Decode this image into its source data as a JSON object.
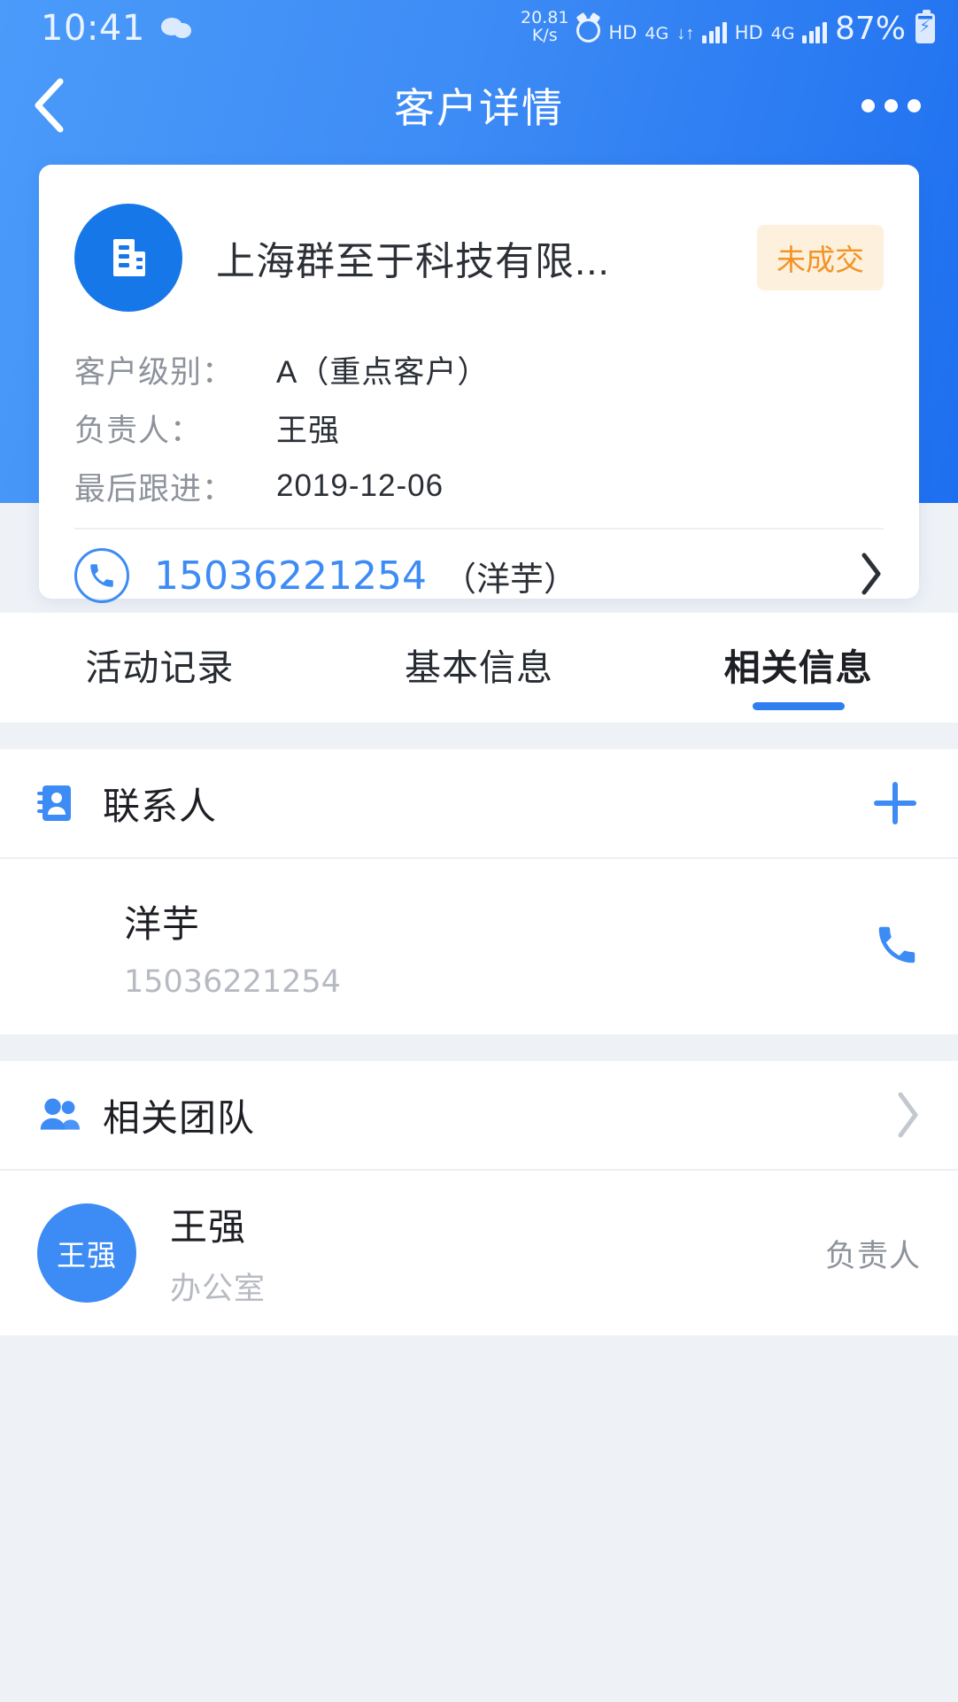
{
  "statusbar": {
    "time": "10:41",
    "wechat_icon": "wechat-icon",
    "net_speed_value": "20.81",
    "net_speed_unit": "K/s",
    "alarm_icon": "alarm-icon",
    "hd1": "HD",
    "sim1_network": "4G",
    "data_arrows": "↓↑",
    "hd2": "HD",
    "sim2_network": "4G",
    "battery_percent": "87%",
    "battery_icon": "battery-charging-icon"
  },
  "nav": {
    "back_icon": "back-chevron-icon",
    "title": "客户详情",
    "more_icon": "more-options-icon"
  },
  "card": {
    "avatar_icon": "company-building-icon",
    "company_name": "上海群至于科技有限...",
    "status_badge": "未成交",
    "status_badge_color": "#f39325",
    "status_badge_bg": "#fdf0dd",
    "rows": [
      {
        "label": "客户级别：",
        "value": "A（重点客户）"
      },
      {
        "label": "负责人：",
        "value": "王强"
      },
      {
        "label": "最后跟进：",
        "value": "2019-12-06"
      }
    ],
    "phone": {
      "icon": "phone-circle-icon",
      "number": "15036221254",
      "owner": "（洋芋）",
      "arrow_icon": "chevron-right-icon"
    }
  },
  "tabs": [
    {
      "label": "活动记录",
      "active": false
    },
    {
      "label": "基本信息",
      "active": false
    },
    {
      "label": "相关信息",
      "active": true
    }
  ],
  "contacts_section": {
    "icon": "contact-card-icon",
    "title": "联系人",
    "add_icon": "plus-icon",
    "items": [
      {
        "name": "洋芋",
        "phone": "15036221254",
        "call_icon": "phone-icon"
      }
    ]
  },
  "team_section": {
    "icon": "team-people-icon",
    "title": "相关团队",
    "arrow_icon": "chevron-right-icon",
    "members": [
      {
        "avatar_text": "王强",
        "name": "王强",
        "department": "办公室",
        "role": "负责人"
      }
    ]
  },
  "theme": {
    "primary": "#3d8bf5",
    "header_gradient_start": "#4a9bfa",
    "header_gradient_end": "#1e6ff0",
    "page_bg": "#eef1f6"
  }
}
